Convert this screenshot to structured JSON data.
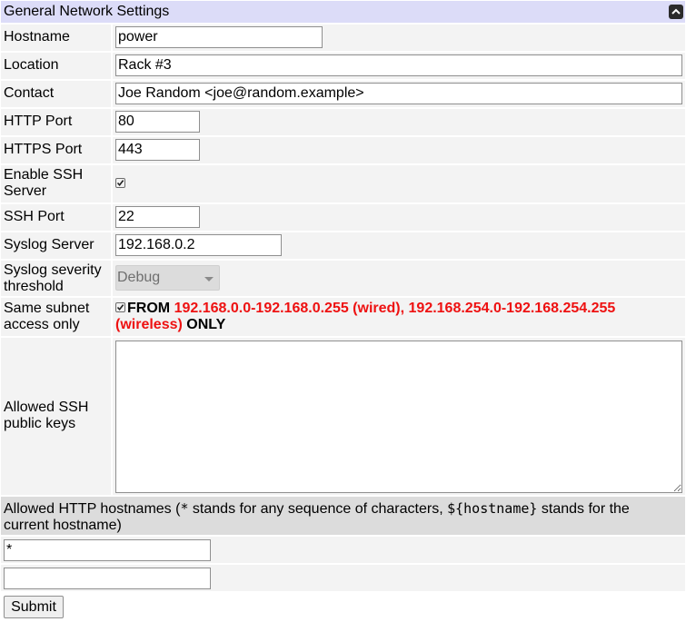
{
  "section": {
    "title": "General Network Settings"
  },
  "fields": {
    "hostname": {
      "label": "Hostname",
      "value": "power"
    },
    "location": {
      "label": "Location",
      "value": "Rack #3"
    },
    "contact": {
      "label": "Contact",
      "value": "Joe Random <joe@random.example>"
    },
    "http_port": {
      "label": "HTTP Port",
      "value": "80"
    },
    "https_port": {
      "label": "HTTPS Port",
      "value": "443"
    },
    "enable_ssh": {
      "label_line1": "Enable SSH",
      "label_line2": "Server",
      "checked": true
    },
    "ssh_port": {
      "label": "SSH Port",
      "value": "22"
    },
    "syslog_server": {
      "label": "Syslog Server",
      "value": "192.168.0.2"
    },
    "syslog_threshold": {
      "label_line1": "Syslog severity",
      "label_line2": "threshold",
      "selected": "Debug"
    },
    "same_subnet": {
      "label_line1": "Same subnet",
      "label_line2": "access only",
      "checked": true,
      "text_from": "FROM",
      "ranges": "192.168.0.0-192.168.0.255 (wired), 192.168.254.0-192.168.254.255 (wireless)",
      "text_only": "ONLY"
    },
    "ssh_keys": {
      "label_line1": "Allowed SSH",
      "label_line2": "public keys",
      "value": ""
    }
  },
  "http_hosts": {
    "label_before": "Allowed HTTP hostnames (",
    "star_token": "*",
    "label_middle": " stands for any sequence of characters, ",
    "hostname_token": "${hostname}",
    "label_after": " stands for the current hostname)",
    "entries": [
      "*",
      ""
    ]
  },
  "actions": {
    "submit_label": "Submit"
  },
  "colors": {
    "header_bg": "#dcdcf8",
    "row_bg": "#f3f3f3",
    "highlight_red": "#ee1111"
  }
}
